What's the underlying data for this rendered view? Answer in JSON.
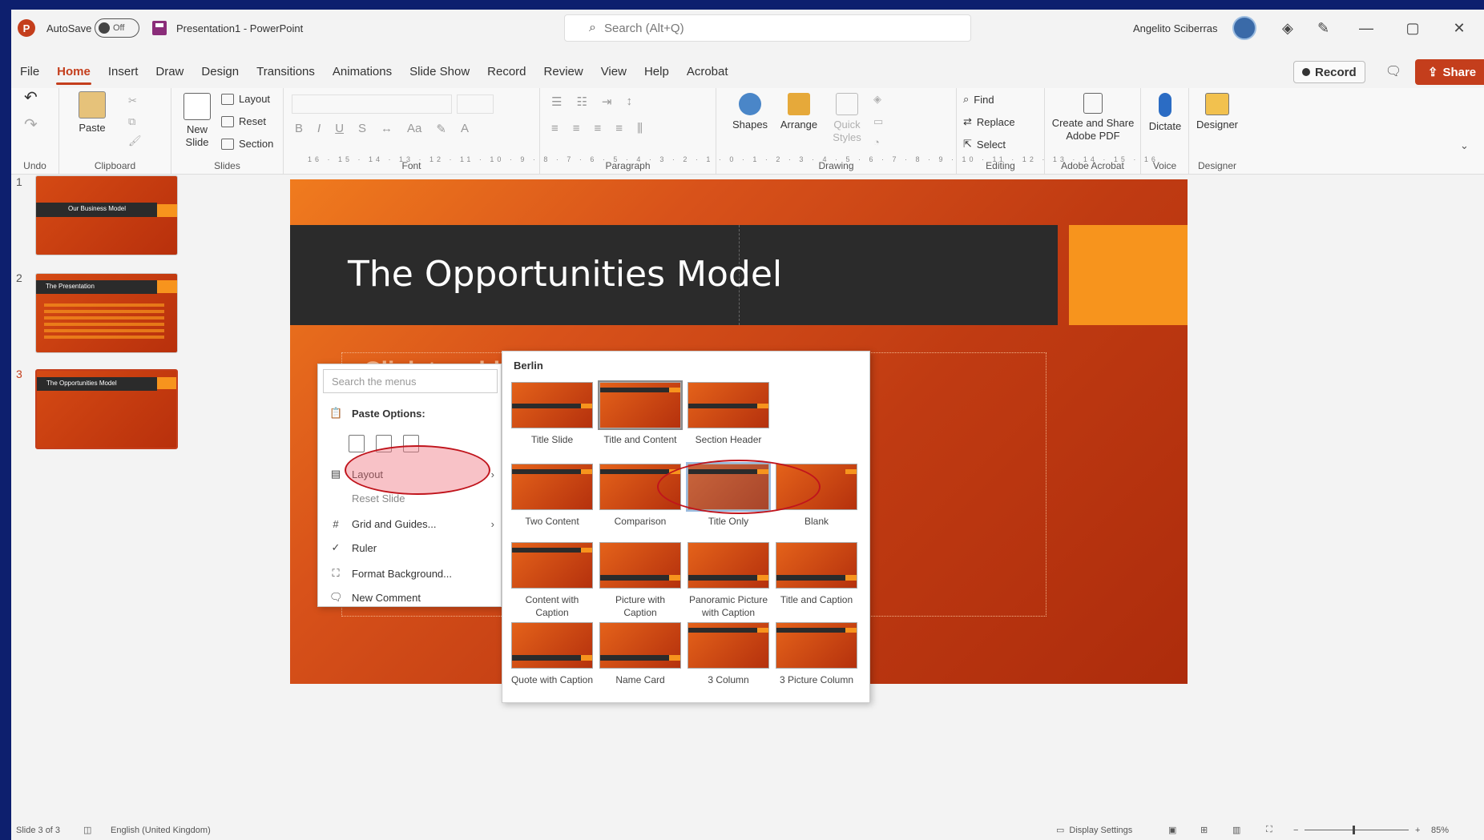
{
  "titlebar": {
    "autosave_label": "AutoSave",
    "autosave_state": "Off",
    "doc_title": "Presentation1 - PowerPoint",
    "search_placeholder": "Search (Alt+Q)",
    "user_name": "Angelito Sciberras",
    "minimize": "—",
    "restore": "▢",
    "close": "✕"
  },
  "tabs": [
    "File",
    "Home",
    "Insert",
    "Draw",
    "Design",
    "Transitions",
    "Animations",
    "Slide Show",
    "Record",
    "Review",
    "View",
    "Help",
    "Acrobat"
  ],
  "active_tab": "Home",
  "record_label": "Record",
  "share_label": "Share",
  "ribbon": {
    "undo_group": "Undo",
    "clipboard": {
      "paste": "Paste",
      "label": "Clipboard"
    },
    "slides": {
      "new_slide": "New Slide",
      "layout": "Layout",
      "reset": "Reset",
      "section": "Section",
      "label": "Slides"
    },
    "font": {
      "label": "Font"
    },
    "paragraph": {
      "label": "Paragraph"
    },
    "drawing": {
      "shapes": "Shapes",
      "arrange": "Arrange",
      "quick_styles": "Quick Styles",
      "label": "Drawing"
    },
    "editing": {
      "find": "Find",
      "replace": "Replace",
      "select": "Select",
      "label": "Editing"
    },
    "acrobat": {
      "create_share": "Create and Share Adobe PDF",
      "label": "Adobe Acrobat"
    },
    "voice": {
      "dictate": "Dictate",
      "label": "Voice"
    },
    "designer": {
      "designer": "Designer",
      "label": "Designer"
    }
  },
  "ruler_ticks": "16 · 15 · 14 · 13 · 12 · 11 · 10 · 9 · 8 · 7 · 6 · 5 · 4 · 3 · 2 · 1 · 0 · 1 · 2 · 3 · 4 · 5 · 6 · 7 · 8 · 9 · 10 · 11 · 12 · 13 · 14 · 15 · 16",
  "slides": [
    {
      "num": "1",
      "title": "Our Business Model"
    },
    {
      "num": "2",
      "title": "The Presentation"
    },
    {
      "num": "3",
      "title": "The Opportunities Model"
    }
  ],
  "current_slide": {
    "title": "The Opportunities Model",
    "content_placeholder": "Click to add text"
  },
  "context_menu": {
    "search_placeholder": "Search the menus",
    "paste_options": "Paste Options:",
    "items": [
      "Layout",
      "Reset Slide",
      "Grid and Guides...",
      "Ruler",
      "Format Background...",
      "New Comment"
    ]
  },
  "layout_gallery": {
    "theme": "Berlin",
    "layouts": [
      "Title Slide",
      "Title and Content",
      "Section Header",
      "Two Content",
      "Comparison",
      "Title Only",
      "Blank",
      "Content with Caption",
      "Picture with Caption",
      "Panoramic Picture with Caption",
      "Title and Caption",
      "Quote with Caption",
      "Name Card",
      "3 Column",
      "3 Picture Column"
    ]
  },
  "statusbar": {
    "slide_count": "Slide 3 of 3",
    "language": "English (United Kingdom)",
    "display_settings": "Display Settings",
    "zoom": "85%"
  },
  "colors": {
    "accent": "#c43e1c",
    "slide_orange": "#d8521a",
    "title_band": "#2b2b2b",
    "accent_square": "#f7941d",
    "annotation_ellipse": "#c0141c"
  }
}
